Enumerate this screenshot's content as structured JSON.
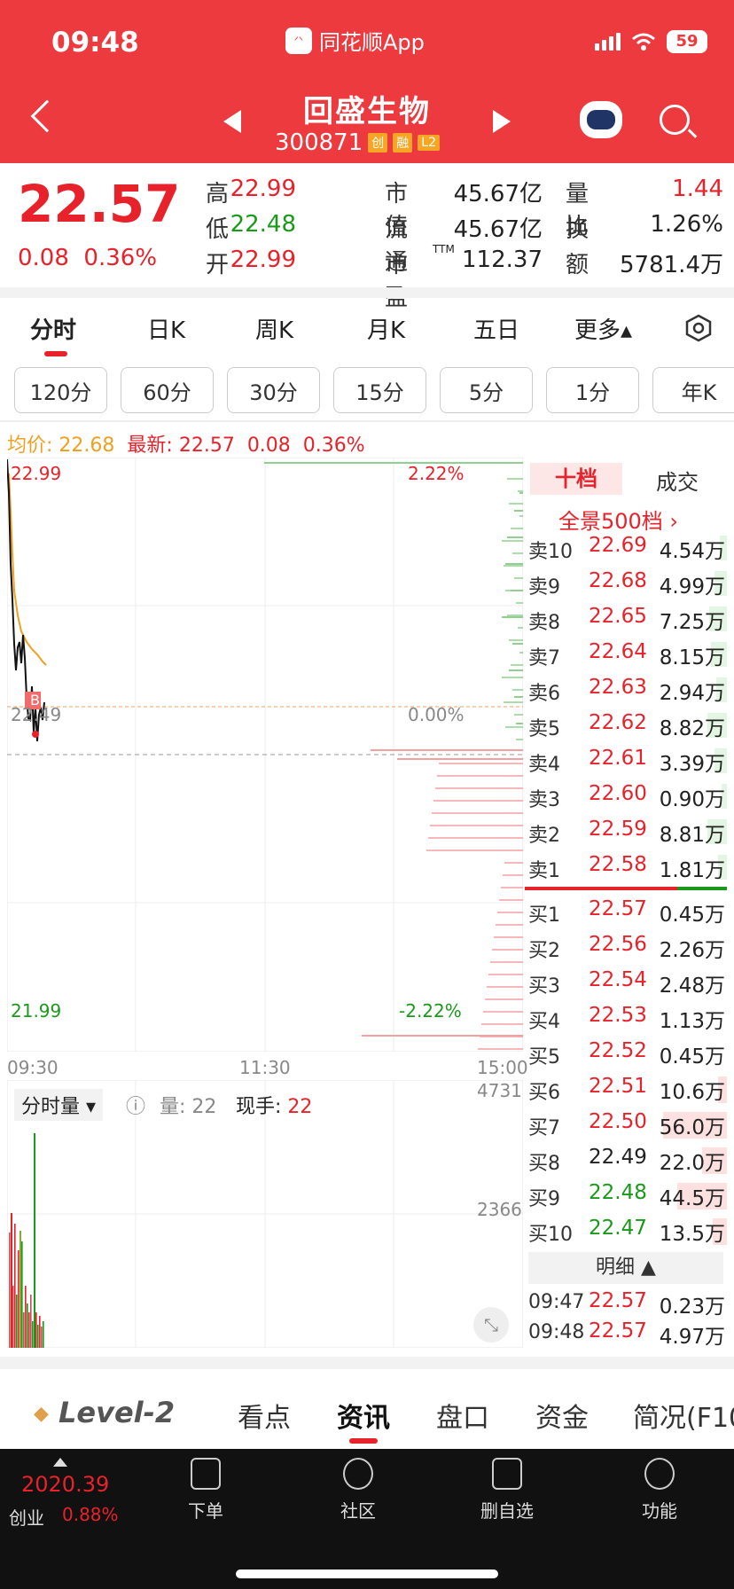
{
  "status": {
    "time": "09:48",
    "app": "同花顺App",
    "battery": "59",
    "logo": "ths"
  },
  "header": {
    "name": "回盛生物",
    "code": "300871",
    "tags": [
      "创",
      "融",
      "L2"
    ]
  },
  "quote": {
    "price": "22.57",
    "change": "0.08",
    "pct": "0.36%",
    "fields": [
      {
        "label": "高",
        "value": "22.99",
        "color": "red"
      },
      {
        "label": "低",
        "value": "22.48",
        "color": "grn"
      },
      {
        "label": "开",
        "value": "22.99",
        "color": "red"
      },
      {
        "label": "市值",
        "value": "45.67亿",
        "color": "blk"
      },
      {
        "label": "流通",
        "value": "45.67亿",
        "color": "blk"
      },
      {
        "label": "市盈",
        "sup": "TTM",
        "value": "112.37",
        "color": "blk"
      },
      {
        "label": "量比",
        "value": "1.44",
        "color": "red"
      },
      {
        "label": "换",
        "value": "1.26%",
        "color": "blk"
      },
      {
        "label": "额",
        "value": "5781.4万",
        "color": "blk"
      }
    ]
  },
  "tabs": [
    "分时",
    "日K",
    "周K",
    "月K",
    "五日",
    "更多▴"
  ],
  "kbtns": [
    "120分",
    "60分",
    "30分",
    "15分",
    "5分",
    "1分",
    "年K"
  ],
  "avgline": {
    "avg_label": "均价:",
    "avg": "22.68",
    "new_label": "最新:",
    "new": "22.57",
    "chg": "0.08",
    "pct": "0.36%"
  },
  "chart": {
    "ymax": "22.99",
    "ymid": "22.49",
    "ymin": "21.99",
    "pmax": "2.22%",
    "pmid": "0.00%",
    "pmin": "-2.22%",
    "t0": "09:30",
    "t1": "11:30",
    "t2": "15:00",
    "b": "B",
    "vmax": "4731",
    "vmid": "2366",
    "vol_sel": "分时量",
    "vol_lbl": "量:",
    "vol_val": "22",
    "hand_lbl": "现手:",
    "hand_val": "22"
  },
  "book": {
    "tab_a": "十档",
    "tab_b": "成交",
    "full": "全景500档 ›",
    "sells": [
      {
        "lb": "卖10",
        "pr": "22.69",
        "vl": "4.54万"
      },
      {
        "lb": "卖9",
        "pr": "22.68",
        "vl": "4.99万"
      },
      {
        "lb": "卖8",
        "pr": "22.65",
        "vl": "7.25万"
      },
      {
        "lb": "卖7",
        "pr": "22.64",
        "vl": "8.15万"
      },
      {
        "lb": "卖6",
        "pr": "22.63",
        "vl": "2.94万"
      },
      {
        "lb": "卖5",
        "pr": "22.62",
        "vl": "8.82万"
      },
      {
        "lb": "卖4",
        "pr": "22.61",
        "vl": "3.39万"
      },
      {
        "lb": "卖3",
        "pr": "22.60",
        "vl": "0.90万"
      },
      {
        "lb": "卖2",
        "pr": "22.59",
        "vl": "8.81万"
      },
      {
        "lb": "卖1",
        "pr": "22.58",
        "vl": "1.81万"
      }
    ],
    "buys": [
      {
        "lb": "买1",
        "pr": "22.57",
        "vl": "0.45万",
        "c": "red"
      },
      {
        "lb": "买2",
        "pr": "22.56",
        "vl": "2.26万",
        "c": "red"
      },
      {
        "lb": "买3",
        "pr": "22.54",
        "vl": "2.48万",
        "c": "red"
      },
      {
        "lb": "买4",
        "pr": "22.53",
        "vl": "1.13万",
        "c": "red"
      },
      {
        "lb": "买5",
        "pr": "22.52",
        "vl": "0.45万",
        "c": "red"
      },
      {
        "lb": "买6",
        "pr": "22.51",
        "vl": "10.6万",
        "c": "red"
      },
      {
        "lb": "买7",
        "pr": "22.50",
        "vl": "56.0万",
        "c": "red"
      },
      {
        "lb": "买8",
        "pr": "22.49",
        "vl": "22.0万",
        "c": "blk"
      },
      {
        "lb": "买9",
        "pr": "22.48",
        "vl": "44.5万",
        "c": "grn"
      },
      {
        "lb": "买10",
        "pr": "22.47",
        "vl": "13.5万",
        "c": "grn"
      }
    ],
    "mingxi": "明细 ▲",
    "trades": [
      {
        "t": "09:47",
        "p": "22.57",
        "v": "0.23万"
      },
      {
        "t": "09:48",
        "p": "22.57",
        "v": "4.97万"
      }
    ]
  },
  "news": {
    "l2": "Level-2",
    "tabs": [
      "看点",
      "资讯",
      "盘口",
      "资金",
      "简况(F10"
    ]
  },
  "bottom": {
    "idx": "2020.39",
    "idxname": "创业",
    "idxpct": "0.88%",
    "items": [
      "下单",
      "社区",
      "删自选",
      "功能"
    ]
  }
}
